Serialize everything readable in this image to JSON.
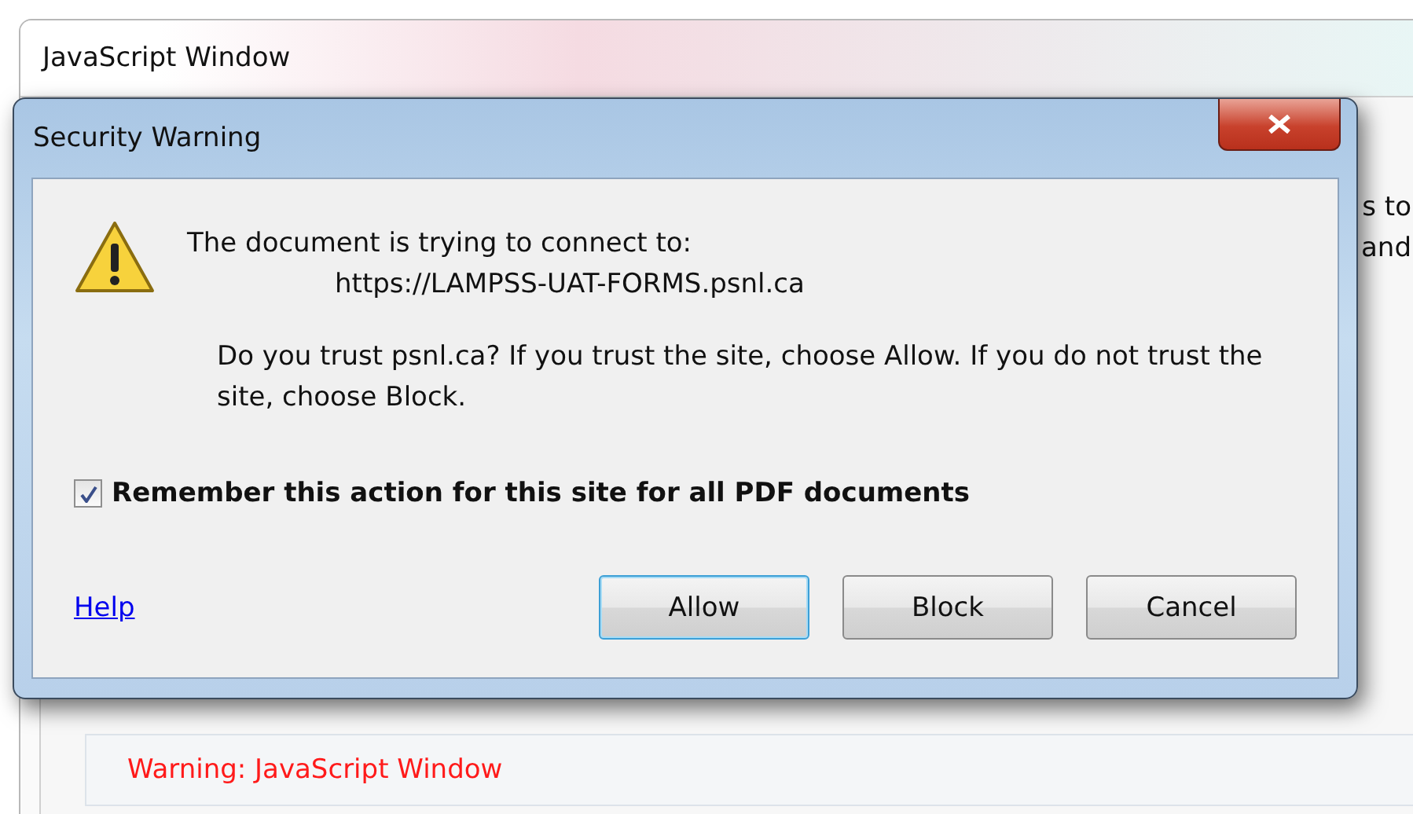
{
  "background_window": {
    "title": "JavaScript Window",
    "side_text": [
      "s to",
      "and"
    ],
    "warning": "Warning: JavaScript Window"
  },
  "dialog": {
    "title": "Security Warning",
    "message_intro": "The document is trying to connect to:",
    "url": "https://LAMPSS-UAT-FORMS.psnl.ca",
    "question": "Do you trust psnl.ca? If you trust the site, choose Allow. If you do not trust the site, choose Block.",
    "remember": {
      "label": "Remember this action for this site for all PDF documents",
      "checked": true
    },
    "help_link": "Help",
    "buttons": [
      {
        "label": "Allow",
        "selected": true
      },
      {
        "label": "Block",
        "selected": false
      },
      {
        "label": "Cancel",
        "selected": false
      }
    ]
  }
}
